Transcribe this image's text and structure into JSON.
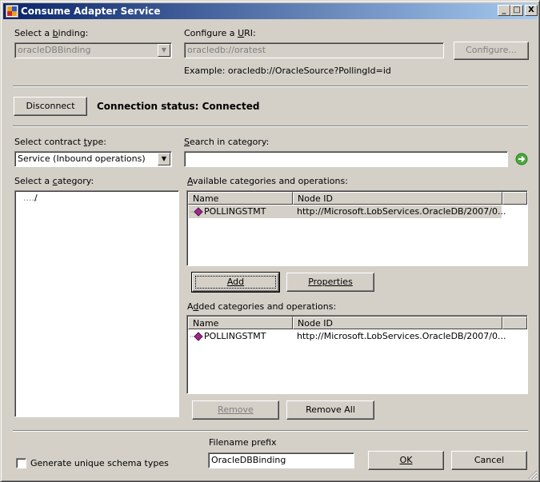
{
  "window": {
    "title": "Consume Adapter Service",
    "minimize": "_",
    "maximize": "□",
    "close": "X"
  },
  "binding": {
    "label_pre": "Select a ",
    "label_key": "b",
    "label_post": "inding:",
    "value": "oracleDBBinding"
  },
  "uri": {
    "label_pre": "Configure a ",
    "label_key": "U",
    "label_post": "RI:",
    "value": "oracledb://oratest",
    "example": "Example: oracledb://OracleSource?PollingId=id",
    "configure_button": "Configure..."
  },
  "connection": {
    "disconnect_button": "Disconnect",
    "status": "Connection status: Connected"
  },
  "contract": {
    "label_pre": "Select contract ",
    "label_key": "t",
    "label_post": "ype:",
    "value": "Service (Inbound operations)"
  },
  "search": {
    "label_pre": "",
    "label_key": "S",
    "label_post": "earch in category:",
    "value": ""
  },
  "category": {
    "label_pre": "Select a ",
    "label_key": "c",
    "label_post": "ategory:",
    "tree_root": "/"
  },
  "available": {
    "label_pre": "",
    "label_key": "A",
    "label_post": "vailable categories and operations:",
    "columns": [
      "Name",
      "Node ID"
    ],
    "rows": [
      {
        "name": "POLLINGSTMT",
        "node_id": "http://Microsoft.LobServices.OracleDB/2007/0..."
      }
    ]
  },
  "actions": {
    "add": "Add",
    "properties": "Properties"
  },
  "added": {
    "label_pre": "A",
    "label_key": "d",
    "label_post": "ded categories and operations:",
    "columns": [
      "Name",
      "Node ID"
    ],
    "rows": [
      {
        "name": "POLLINGSTMT",
        "node_id": "http://Microsoft.LobServices.OracleDB/2007/0..."
      }
    ]
  },
  "removal": {
    "remove": "Remove",
    "remove_all": "Remove All"
  },
  "footer": {
    "unique_schema_label": "Generate unique schema types",
    "unique_schema_checked": false,
    "filename_prefix_label": "Filename prefix",
    "filename_prefix_value": "OracleDBBinding",
    "ok": "OK",
    "cancel": "Cancel"
  },
  "colors": {
    "title_start": "#0a246a",
    "title_end": "#a6caf0",
    "face": "#d4d0c8",
    "selection": "#d4d0c8",
    "op_icon": "#9b2a8a"
  }
}
